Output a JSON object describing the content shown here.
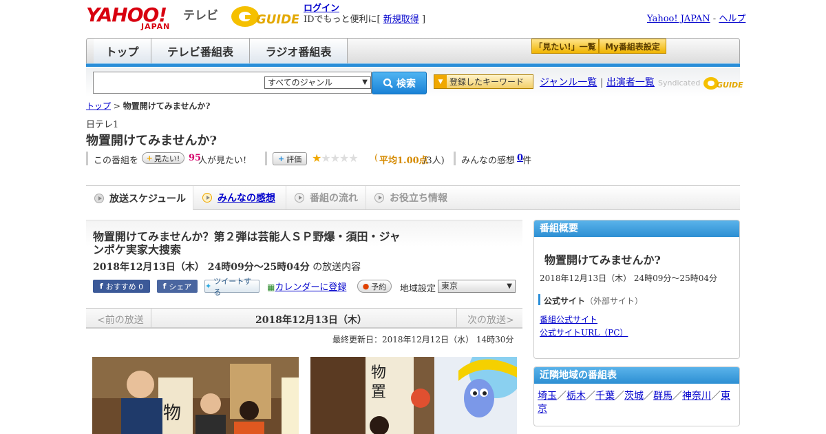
{
  "header": {
    "logo_text": "YAHOO!",
    "logo_sub": "JAPAN",
    "service": "テレビ",
    "gguide_logo": "G GUIDE",
    "login": "ログイン",
    "login_sub_prefix": "IDでもっと便利に[",
    "signup": "新規取得",
    "login_sub_suffix": "]",
    "yahoo_japan": "Yahoo! JAPAN",
    "sep": "-",
    "help": "ヘルプ"
  },
  "nav": {
    "tabs": [
      "トップ",
      "テレビ番組表",
      "ラジオ番組表"
    ],
    "mitai_list": "「見たい!」一覧",
    "my_settings": "My番組表設定"
  },
  "search": {
    "genre_select": "すべてのジャンル",
    "search_button": "検索",
    "keyword_button": "登録したキーワード",
    "genre_list": "ジャンル一覧",
    "divider": "|",
    "cast_list": "出演者一覧",
    "syndicated": "Syndicated"
  },
  "breadcrumb": {
    "top": "トップ",
    "sep": ">",
    "current": "物置開けてみませんか?"
  },
  "program": {
    "station": "日テレ1",
    "title": "物置開けてみませんか?",
    "this_program": "この番組を",
    "mitai_btn": "見たい!",
    "mitai_count": "95",
    "mitai_suffix": "人が見たい!",
    "rate_btn": "評価",
    "stars": "★★★★★",
    "rating_prefix": "(",
    "rating_avg": "平均1.00点",
    "rating_suffix": "/3人)",
    "rating_value": 1,
    "rating_max": 5,
    "comments_label": "みんなの感想",
    "comments_count": "0",
    "comments_suffix": "件"
  },
  "page_tabs": [
    "放送スケジュール",
    "みんなの感想",
    "番組の流れ",
    "お役立ち情報"
  ],
  "episode": {
    "title": "物置開けてみませんか？第２弾は芸能人ＳＰ野爆・須田・ジャンポケ実家大捜索",
    "time": "2018年12月13日（木） 24時09分～25時04分",
    "time_suffix": "の放送内容",
    "fb_recommend": "おすすめ 0",
    "fb_share": "シェア",
    "tweet": "ツイートする",
    "calendar": "カレンダーに登録",
    "reserve": "予約",
    "region_label": "地域設定",
    "region": "東京",
    "prev": "<前の放送",
    "date": "2018年12月13日（木）",
    "next": "次の放送>",
    "updated": "最終更新日：2018年12月12日（水） 14時30分"
  },
  "sidebar": {
    "overview_head": "番組概要",
    "overview_title": "物置開けてみませんか?",
    "overview_time": "2018年12月13日（木） 24時09分～25時04分",
    "official_label": "公式サイト",
    "official_note": "（外部サイト）",
    "link1": "番組公式サイト",
    "link2": "公式サイトURL（PC）",
    "nearby_head": "近隣地域の番組表",
    "regions": [
      "埼玉",
      "栃木",
      "千葉",
      "茨城",
      "群馬",
      "神奈川",
      "東京"
    ],
    "region_sep": "／"
  },
  "colors": {
    "yahoo_red": "#d8000f",
    "accent_blue": "#2a8ed8",
    "rating_orange": "#d58a00",
    "mitai_pink": "#d4006a"
  }
}
